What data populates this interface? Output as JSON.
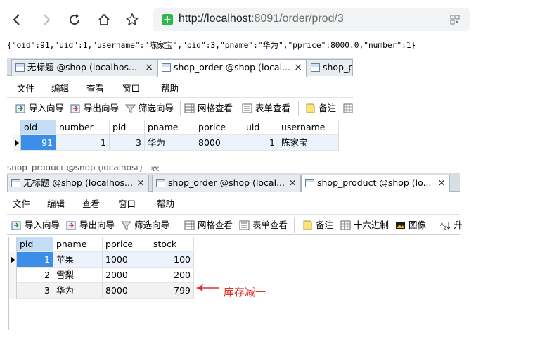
{
  "browser": {
    "url_host": "http://localhost",
    "url_rest": ":8091/order/prod/3",
    "secure_icon": "shield-check-icon"
  },
  "json_response": "{\"oid\":91,\"uid\":1,\"username\":\"陈家宝\",\"pid\":3,\"pname\":\"华为\",\"pprice\":8000.0,\"number\":1}",
  "window1": {
    "tabs": [
      {
        "label": "无标题 @shop (localhos..."
      },
      {
        "label": "shop_order @shop (local..."
      },
      {
        "label": "shop_p"
      }
    ],
    "menu": [
      "文件",
      "编辑",
      "查看",
      "窗口",
      "帮助"
    ],
    "toolbar": [
      "导入向导",
      "导出向导",
      "筛选向导",
      "网格查看",
      "表单查看",
      "备注"
    ],
    "columns": [
      "oid",
      "number",
      "pid",
      "pname",
      "pprice",
      "uid",
      "username"
    ],
    "rows": [
      [
        "91",
        "1",
        "3",
        "华为",
        "8000",
        "1",
        "陈家宝"
      ]
    ]
  },
  "ghost_title": "shop_product @shop (localhost) - 表",
  "window2": {
    "tabs": [
      {
        "label": "无标题 @shop (localhos..."
      },
      {
        "label": "shop_order @shop (local..."
      },
      {
        "label": "shop_product @shop (lo..."
      }
    ],
    "menu": [
      "文件",
      "编辑",
      "查看",
      "窗口",
      "帮助"
    ],
    "toolbar": [
      "导入向导",
      "导出向导",
      "筛选向导",
      "网格查看",
      "表单查看",
      "备注",
      "十六进制",
      "图像",
      "升"
    ],
    "columns": [
      "pid",
      "pname",
      "pprice",
      "stock"
    ],
    "rows": [
      [
        "1",
        "苹果",
        "1000",
        "100"
      ],
      [
        "2",
        "雪梨",
        "2000",
        "200"
      ],
      [
        "3",
        "华为",
        "8000",
        "799"
      ]
    ]
  },
  "annotation": "库存减一",
  "colors": {
    "accent_select": "#3d8ee8",
    "annotation": "#e0302c",
    "secure": "#2eb84a"
  }
}
